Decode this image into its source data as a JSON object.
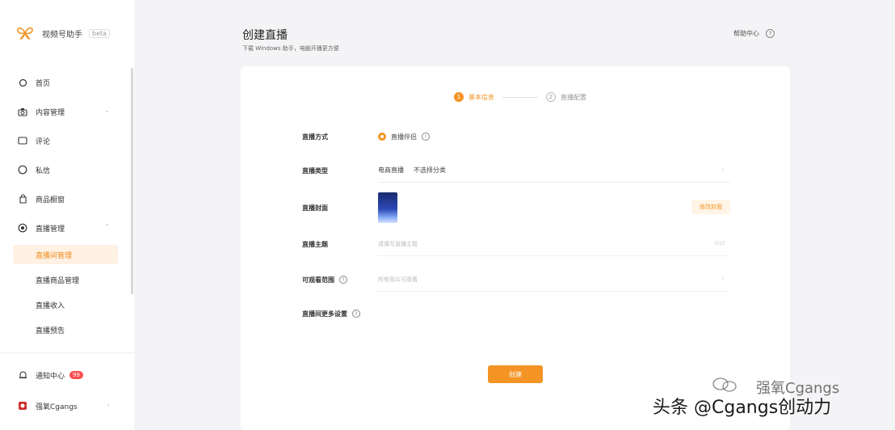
{
  "brand": {
    "name": "视频号助手",
    "beta": "beta"
  },
  "sidebar": {
    "items": [
      {
        "label": "首页"
      },
      {
        "label": "内容管理"
      },
      {
        "label": "评论"
      },
      {
        "label": "私信"
      },
      {
        "label": "商品橱窗"
      },
      {
        "label": "直播管理"
      }
    ],
    "sub_items": [
      {
        "label": "直播间管理"
      },
      {
        "label": "直播商品管理"
      },
      {
        "label": "直播收入"
      },
      {
        "label": "直播预告"
      }
    ],
    "notifications": {
      "label": "通知中心",
      "count": "99"
    },
    "account": {
      "label": "强氧Cgangs"
    }
  },
  "header": {
    "title": "创建直播",
    "subtitle": "下载 Windows 助手，电脑开播更方便",
    "help": "帮助中心",
    "help_icon": "?"
  },
  "steps": [
    {
      "num": "1",
      "label": "基本信息"
    },
    {
      "num": "2",
      "label": "直播配置"
    }
  ],
  "form": {
    "method": {
      "label": "直播方式",
      "option": "直播伴侣"
    },
    "type": {
      "label": "直播类型",
      "value1": "电商直播",
      "value2": "不选择分类"
    },
    "cover": {
      "label": "直播封面",
      "button": "修改封面"
    },
    "topic": {
      "label": "直播主题",
      "placeholder": "请填写直播主题",
      "counter": "0/20"
    },
    "visible": {
      "label": "可观看范围",
      "placeholder": "所有观众可观看"
    },
    "more": {
      "label": "直播间更多设置"
    },
    "submit": "创建"
  },
  "watermark": {
    "line1": "强氧Cgangs",
    "line2": "头条 @Cgangs创动力"
  }
}
